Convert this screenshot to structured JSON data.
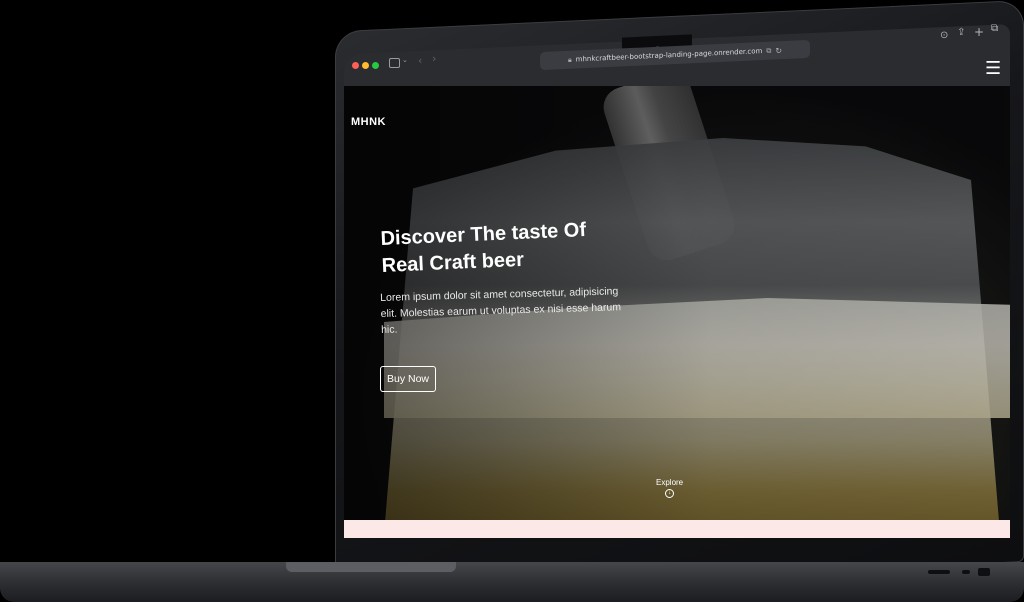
{
  "browser": {
    "url": "mhnkcraftbeer-bootstrap-landing-page.onrender.com",
    "traffic_colors": {
      "close": "#ff5f57",
      "minimize": "#febc2e",
      "zoom": "#28c840"
    },
    "toolbar_icons": [
      "sidebar-icon",
      "back-icon",
      "forward-icon",
      "download-icon",
      "share-icon",
      "new-tab-icon",
      "tabs-overview-icon"
    ]
  },
  "site": {
    "brand": "MHNK",
    "hero": {
      "title": "Discover The taste Of Real Craft beer",
      "description": "Lorem ipsum dolor sit amet consectetur, adipisicing elit. Molestias earum ut voluptas ex nisi esse harum hic.",
      "cta_label": "Buy Now"
    },
    "explore_label": "Explore",
    "colors": {
      "text": "#ffffff",
      "next_section": "#fde8e8"
    }
  }
}
